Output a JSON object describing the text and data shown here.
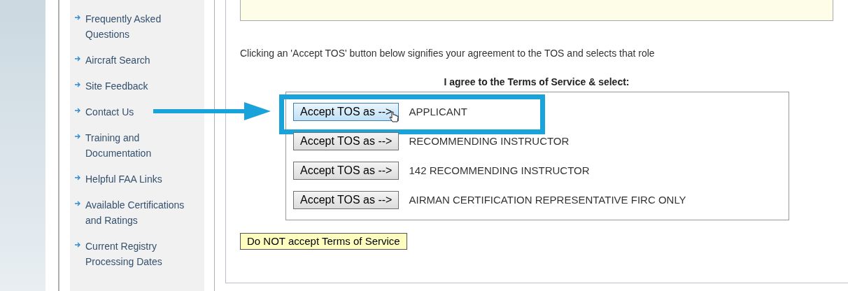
{
  "sidebar": {
    "items": [
      {
        "label": "Frequently Asked Questions"
      },
      {
        "label": "Aircraft Search"
      },
      {
        "label": "Site Feedback"
      },
      {
        "label": "Contact Us"
      },
      {
        "label": "Training and Documentation"
      },
      {
        "label": "Helpful FAA Links"
      },
      {
        "label": "Available Certifications and Ratings"
      },
      {
        "label": "Current Registry Processing Dates"
      }
    ]
  },
  "main": {
    "instruction": "Clicking an 'Accept TOS' button below signifies your agreement to the TOS and selects that role",
    "heading": "I agree to the Terms of Service & select:",
    "roles": [
      {
        "button": "Accept TOS as -->",
        "role": "APPLICANT",
        "hovered": true,
        "highlighted": true
      },
      {
        "button": "Accept TOS as -->",
        "role": "RECOMMENDING INSTRUCTOR",
        "hovered": false,
        "highlighted": false
      },
      {
        "button": "Accept TOS as -->",
        "role": "142 RECOMMENDING INSTRUCTOR",
        "hovered": false,
        "highlighted": false
      },
      {
        "button": "Accept TOS as -->",
        "role": "AIRMAN CERTIFICATION REPRESENTATIVE FIRC ONLY",
        "hovered": false,
        "highlighted": false
      }
    ],
    "decline_button": "Do NOT accept Terms of Service"
  }
}
